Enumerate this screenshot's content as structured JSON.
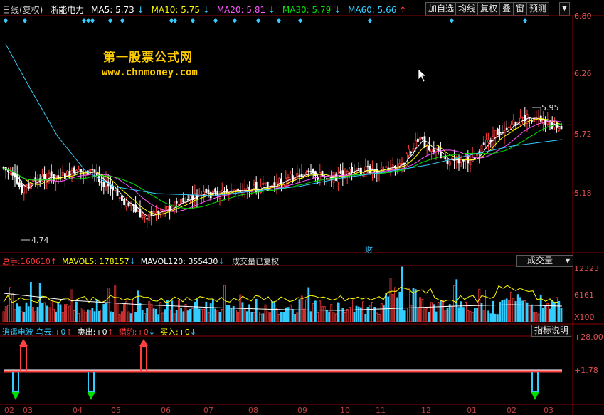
{
  "header": {
    "period": "日线(复权)",
    "stock": "浙能电力",
    "ma": [
      {
        "label": "MA5: 5.73",
        "arrow": "↓",
        "color": "#ffffff"
      },
      {
        "label": "MA10: 5.75",
        "arrow": "↓",
        "color": "#ffff00"
      },
      {
        "label": "MA20: 5.81",
        "arrow": "↓",
        "color": "#ff55ff"
      },
      {
        "label": "MA30: 5.79",
        "arrow": "↓",
        "color": "#00e000"
      },
      {
        "label": "MA60: 5.66",
        "arrow": "↑",
        "color": "#33ccff"
      }
    ]
  },
  "toolbar": {
    "add_fav": "加自选",
    "ma_line": "均线",
    "restore": "复权",
    "overlay": "叠",
    "window": "窗",
    "forecast": "预测",
    "menu_arrow": "▼"
  },
  "watermark": {
    "line1": "第一股票公式网",
    "line2": "www.chnmoney.com"
  },
  "price_axis": {
    "ticks": [
      "6.80",
      "6.26",
      "5.72",
      "5.18"
    ]
  },
  "price_annotations": {
    "high": "5.95",
    "low": "4.74",
    "finance_mark": "财"
  },
  "volume": {
    "total_label": "总手:",
    "total_value": "160610",
    "total_arrow": "↑",
    "mavol5_label": "MAVOL5:",
    "mavol5_value": "178157",
    "mavol5_arrow": "↓",
    "mavol120_label": "MAVOL120:",
    "mavol120_value": "355430",
    "mavol120_arrow": "↓",
    "note": "成交量已复权",
    "selector": "成交量",
    "ticks": [
      "12323",
      "6161",
      "X100"
    ]
  },
  "indicator": {
    "name": "逍遥电波",
    "items": [
      {
        "label": "乌云:",
        "value": "+0",
        "arrow": "↑",
        "color": "#33ccff"
      },
      {
        "label": "卖出:",
        "value": "+0",
        "arrow": "↑",
        "color": "#ffffff"
      },
      {
        "label": "猎豹:",
        "value": "+0",
        "arrow": "↓",
        "color": "#ff3b3b"
      },
      {
        "label": "买入:",
        "value": "+0",
        "arrow": "↓",
        "color": "#ffff00"
      }
    ],
    "help": "指标说明",
    "ticks": [
      "+28.00",
      "+1.78"
    ]
  },
  "x_axis": {
    "labels": [
      "02",
      "03",
      "04",
      "05",
      "06",
      "07",
      "08",
      "09",
      "10",
      "11",
      "12",
      "01",
      "02",
      "03"
    ]
  },
  "colors": {
    "up": "#ff3b3b",
    "down": "#33ccff",
    "grid": "#8b0000",
    "bg": "#000000"
  }
}
